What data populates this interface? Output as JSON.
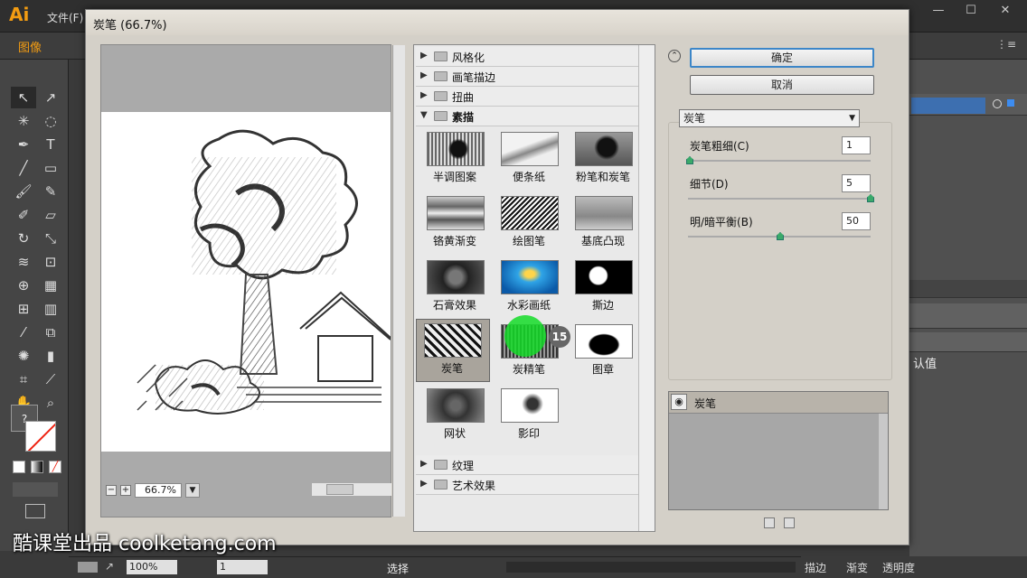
{
  "app": {
    "logo": "Ai",
    "menu_file": "文件(F)",
    "control_label": "图像"
  },
  "dialog": {
    "title": "炭笔 (66.7%)",
    "zoom": "66.7%"
  },
  "categories": [
    {
      "label": "风格化",
      "open": false
    },
    {
      "label": "画笔描边",
      "open": false
    },
    {
      "label": "扭曲",
      "open": false
    },
    {
      "label": "素描",
      "open": true
    },
    {
      "label": "纹理",
      "open": false
    },
    {
      "label": "艺术效果",
      "open": false
    }
  ],
  "thumbnails": [
    {
      "label": "半调图案"
    },
    {
      "label": "便条纸"
    },
    {
      "label": "粉笔和炭笔"
    },
    {
      "label": "铬黄渐变"
    },
    {
      "label": "绘图笔"
    },
    {
      "label": "基底凸现"
    },
    {
      "label": "石膏效果"
    },
    {
      "label": "水彩画纸"
    },
    {
      "label": "撕边"
    },
    {
      "label": "炭笔",
      "selected": true
    },
    {
      "label": "炭精笔"
    },
    {
      "label": "图章"
    },
    {
      "label": "网状"
    },
    {
      "label": "影印"
    }
  ],
  "buttons": {
    "ok": "确定",
    "cancel": "取消"
  },
  "filter_select": "炭笔",
  "params": [
    {
      "label": "炭笔粗细(C)",
      "value": "1",
      "level": 0.0
    },
    {
      "label": "细节(D)",
      "value": "5",
      "level": 1.0
    },
    {
      "label": "明/暗平衡(B)",
      "value": "50",
      "level": 0.5
    }
  ],
  "layer": {
    "name": "炭笔"
  },
  "cursor_badge": "15",
  "status": {
    "zoom": "100%",
    "page": "1",
    "tool": "选择"
  },
  "right_panel": {
    "value_text": "认值"
  },
  "bottom_tabs": [
    "描边",
    "渐变",
    "透明度"
  ],
  "watermark": "酷课堂出品 coolketang.com",
  "colors": {
    "accent_orange": "#f39c12",
    "ok_border": "#3c86c8",
    "cursor": "#14dc28",
    "slider_knob": "#3aa96a"
  }
}
